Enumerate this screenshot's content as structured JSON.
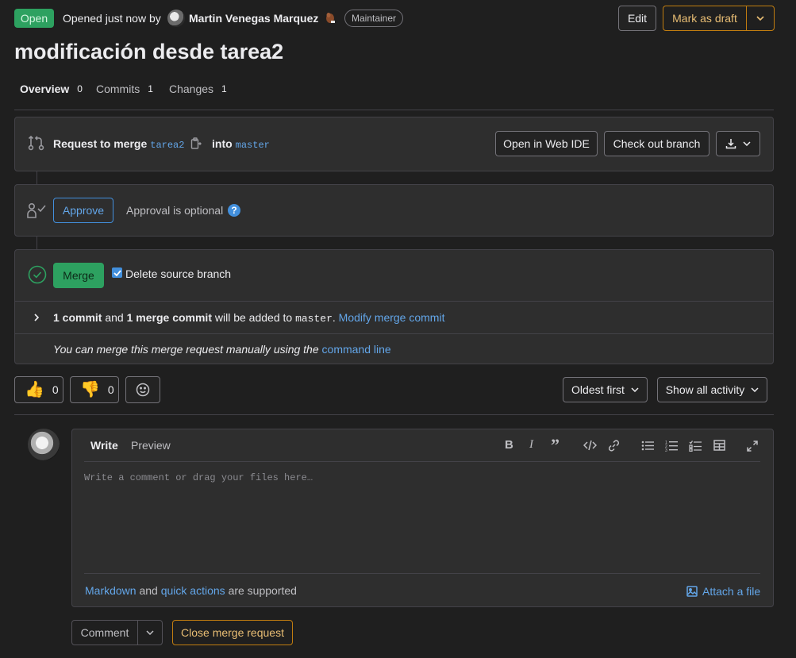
{
  "header": {
    "status_badge": "Open",
    "opened_text": "Opened just now by",
    "author_name": "Martin Venegas Marquez",
    "role_badge": "Maintainer",
    "edit_label": "Edit",
    "draft_label": "Mark as draft",
    "title": "modificación desde tarea2"
  },
  "tabs": [
    {
      "label": "Overview",
      "count": "0"
    },
    {
      "label": "Commits",
      "count": "1"
    },
    {
      "label": "Changes",
      "count": "1"
    }
  ],
  "merge_info": {
    "request_label": "Request to merge",
    "source_branch": "tarea2",
    "into_label": "into",
    "target_branch": "master",
    "web_ide_label": "Open in Web IDE",
    "checkout_label": "Check out branch"
  },
  "approval": {
    "approve_label": "Approve",
    "optional_text": "Approval is optional"
  },
  "merge": {
    "merge_label": "Merge",
    "delete_label": "Delete source branch",
    "commit_count": "1 commit",
    "and_text": "and",
    "merge_commit": "1 merge commit",
    "will_be_added": "will be added to",
    "target_branch": "master",
    "period": ".",
    "modify_link": "Modify merge commit",
    "manual_text": "You can merge this merge request manually using the",
    "command_line_link": "command line"
  },
  "reactions": {
    "thumbs_up_count": "0",
    "thumbs_down_count": "0"
  },
  "activity": {
    "sort_label": "Oldest first",
    "filter_label": "Show all activity"
  },
  "comment": {
    "write_tab": "Write",
    "preview_tab": "Preview",
    "placeholder": "Write a comment or drag your files here…",
    "markdown_link": "Markdown",
    "and_text": "and",
    "quick_actions_link": "quick actions",
    "supported_text": "are supported",
    "attach_label": "Attach a file",
    "comment_label": "Comment",
    "close_label": "Close merge request"
  },
  "colors": {
    "success": "#2da160",
    "link": "#63a6e9",
    "warning": "#c17d10",
    "background": "#1f1f1f",
    "panel": "#2e2e2e"
  }
}
